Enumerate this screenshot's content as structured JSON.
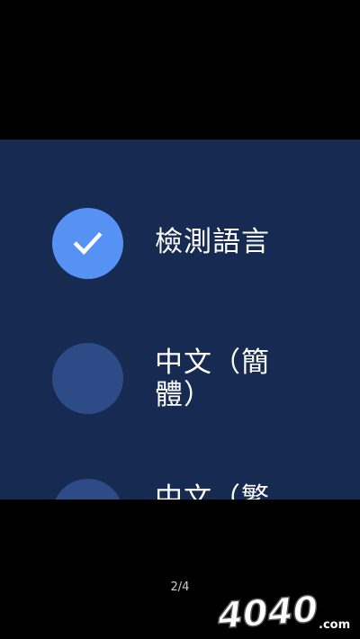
{
  "options": [
    {
      "label": "檢測語言",
      "selected": true
    },
    {
      "label": "中文（簡體）",
      "selected": false
    },
    {
      "label": "中文（繁",
      "selected": false
    }
  ],
  "pager": {
    "text": "2/4"
  },
  "watermark": {
    "text": "4040",
    "suffix": ".com"
  },
  "colors": {
    "background": "#000000",
    "panel": "#172a52",
    "selected_circle": "#5692f4",
    "unselected_circle": "#2d4b86",
    "text": "#ffffff"
  }
}
